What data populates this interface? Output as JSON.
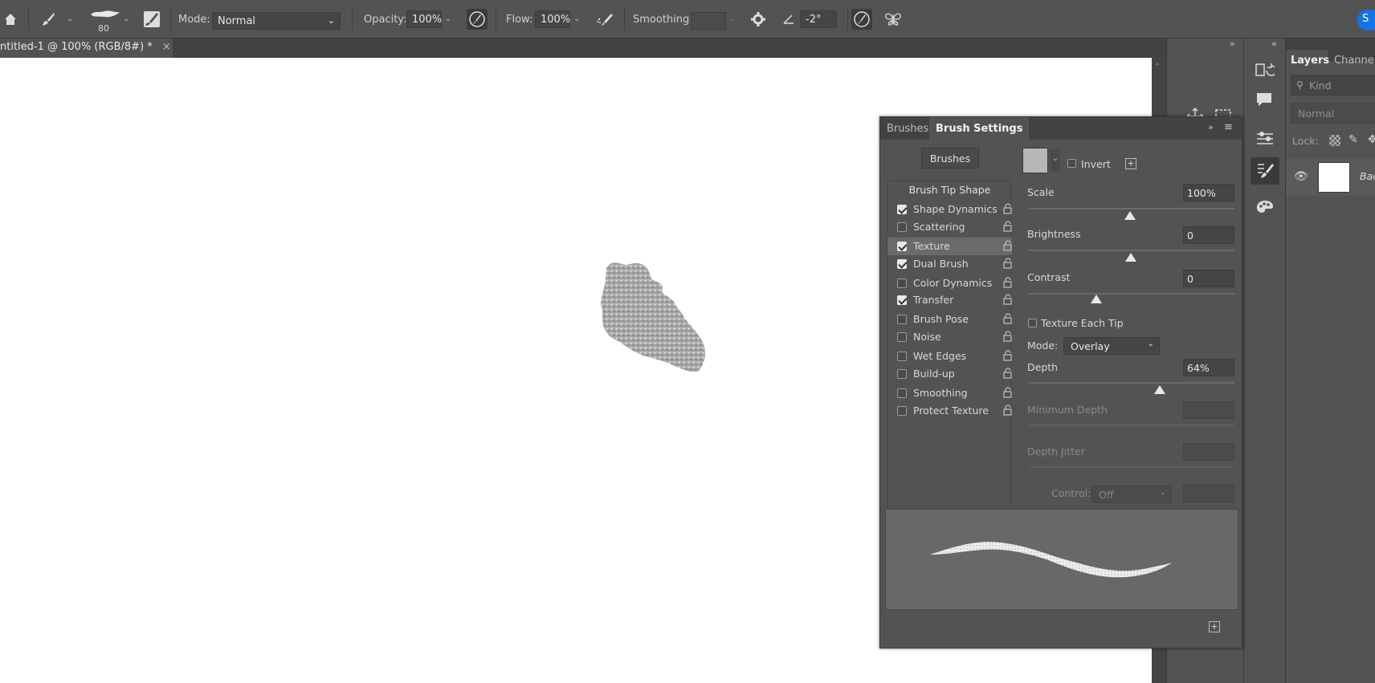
{
  "options_bar": {
    "brush_size": "80",
    "mode_label": "Mode:",
    "mode_value": "Normal",
    "opacity_label": "Opacity:",
    "opacity_value": "100%",
    "flow_label": "Flow:",
    "flow_value": "100%",
    "smoothing_label": "Smoothing:",
    "angle_value": "-2°"
  },
  "document_tab": {
    "title": "ntitled-1 @ 100% (RGB/8#) *",
    "close": "×"
  },
  "brush_panel": {
    "tabs": [
      "Brushes",
      "Brush Settings"
    ],
    "brushes_button": "Brushes",
    "brush_tip_shape": "Brush Tip Shape",
    "options": [
      {
        "label": "Shape Dynamics",
        "checked": true
      },
      {
        "label": "Scattering",
        "checked": false
      },
      {
        "label": "Texture",
        "checked": true,
        "selected": true
      },
      {
        "label": "Dual Brush",
        "checked": true
      },
      {
        "label": "Color Dynamics",
        "checked": false
      },
      {
        "label": "Transfer",
        "checked": true
      },
      {
        "label": "Brush Pose",
        "checked": false
      },
      {
        "label": "Noise",
        "checked": false
      },
      {
        "label": "Wet Edges",
        "checked": false
      },
      {
        "label": "Build-up",
        "checked": false
      },
      {
        "label": "Smoothing",
        "checked": false
      },
      {
        "label": "Protect Texture",
        "checked": false
      }
    ],
    "texture": {
      "invert_label": "Invert",
      "scale_label": "Scale",
      "scale_value": "100%",
      "brightness_label": "Brightness",
      "brightness_value": "0",
      "contrast_label": "Contrast",
      "contrast_value": "0",
      "texture_each_tip_label": "Texture Each Tip",
      "mode_label": "Mode:",
      "mode_value": "Overlay",
      "depth_label": "Depth",
      "depth_value": "64%",
      "min_depth_label": "Minimum Depth",
      "depth_jitter_label": "Depth Jitter",
      "control_label": "Control:",
      "control_value": "Off"
    }
  },
  "layers_panel": {
    "tabs": [
      "Layers",
      "Channels"
    ],
    "kind_placeholder": "Kind",
    "blend_mode": "Normal",
    "lock_label": "Lock:",
    "layer_name": "Bac"
  },
  "colors": {
    "panel_bg": "#535353",
    "canvas_bg": "#ffffff",
    "accent_blue": "#1473e6"
  }
}
